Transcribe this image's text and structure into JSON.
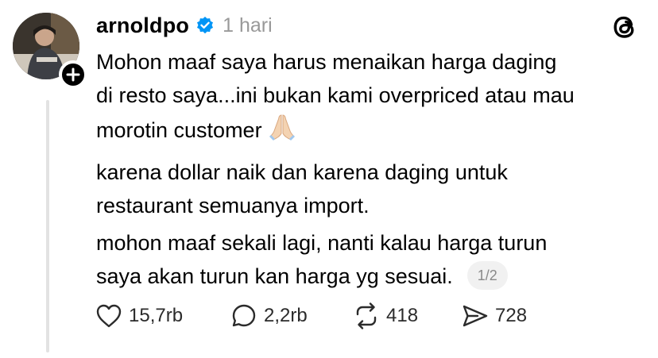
{
  "post": {
    "username": "arnoldpo",
    "timestamp": "1 hari",
    "paragraphs": [
      {
        "line1": "Mohon maaf saya harus menaikan harga daging",
        "line2": "di resto saya...ini bukan kami overpriced atau mau",
        "line3": "morotin customer"
      },
      {
        "line1": "karena dollar naik dan karena daging untuk",
        "line2": "restaurant semuanya import."
      },
      {
        "line1": "mohon maaf sekali lagi, nanti kalau harga turun",
        "line2": "saya akan turun kan harga yg sesuai."
      }
    ],
    "emoji": "folded-hands",
    "thread_counter": "1/2"
  },
  "actions": {
    "likes": "15,7rb",
    "replies": "2,2rb",
    "reposts": "418",
    "shares": "728"
  },
  "colors": {
    "verified": "#0095f6",
    "muted_text": "#999999",
    "thread_line": "#e2e2e2"
  },
  "icons": [
    "plus-icon",
    "verified-badge-icon",
    "threads-logo-icon",
    "heart-icon",
    "comment-icon",
    "repost-icon",
    "share-icon"
  ]
}
